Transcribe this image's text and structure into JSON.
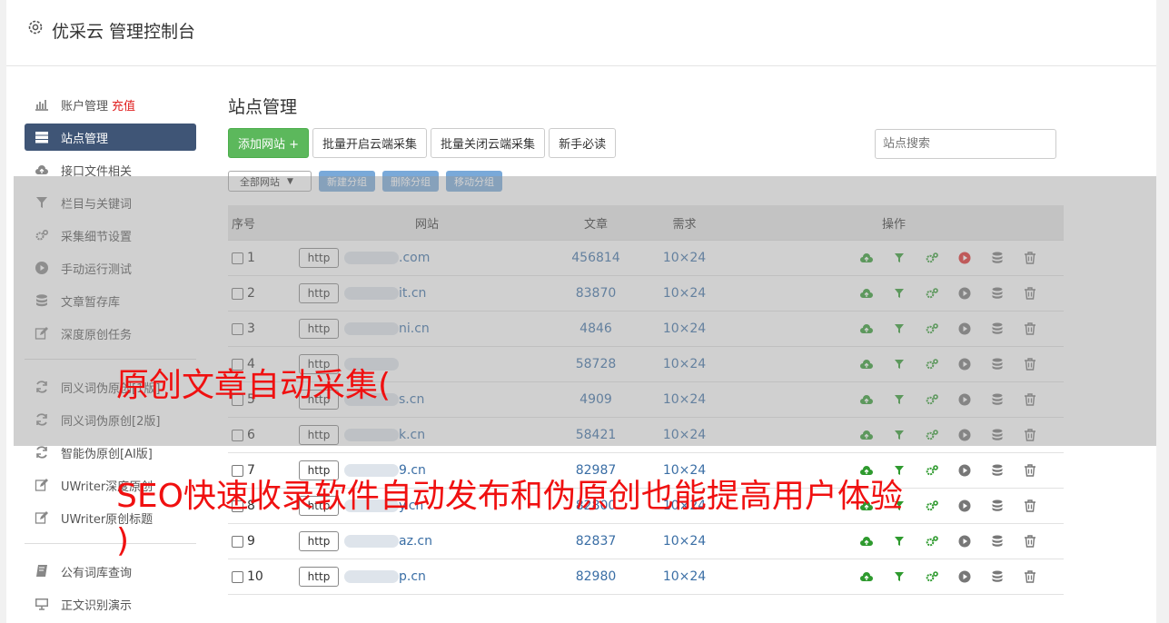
{
  "app": {
    "title": "优采云 管理控制台"
  },
  "sidebar": {
    "items": [
      {
        "label": "账户管理",
        "extra": "充值",
        "icon": "bar-chart-icon"
      },
      {
        "label": "站点管理",
        "icon": "server-icon",
        "active": true
      },
      {
        "label": "接口文件相关",
        "icon": "cloud-upload-icon"
      },
      {
        "label": "栏目与关键词",
        "icon": "filter-icon"
      },
      {
        "label": "采集细节设置",
        "icon": "gears-icon"
      },
      {
        "label": "手动运行测试",
        "icon": "play-circle-icon"
      },
      {
        "label": "文章暂存库",
        "icon": "database-icon"
      },
      {
        "label": "深度原创任务",
        "icon": "edit-icon"
      }
    ],
    "items2": [
      {
        "label": "同义词伪原创[1版]",
        "icon": "refresh-icon"
      },
      {
        "label": "同义词伪原创[2版]",
        "icon": "refresh-icon"
      },
      {
        "label": "智能伪原创[AI版]",
        "icon": "refresh-icon"
      },
      {
        "label": "UWriter深度原创",
        "icon": "edit-icon"
      },
      {
        "label": "UWriter原创标题",
        "icon": "edit-icon"
      }
    ],
    "items3": [
      {
        "label": "公有词库查询",
        "icon": "book-icon"
      },
      {
        "label": "正文识别演示",
        "icon": "monitor-icon"
      }
    ]
  },
  "content": {
    "title": "站点管理",
    "toolbar": {
      "add_site": "添加网站 +",
      "batch_open": "批量开启云端采集",
      "batch_close": "批量关闭云端采集",
      "newbie": "新手必读"
    },
    "search_placeholder": "站点搜索",
    "group_select": "全部网站",
    "group_buttons": {
      "new": "新建分组",
      "delete": "删除分组",
      "move": "移动分组"
    },
    "table": {
      "headers": {
        "no": "序号",
        "site": "网站",
        "articles": "文章",
        "demand": "需求",
        "ops": "操作"
      },
      "http_label": "http",
      "rows": [
        {
          "no": "1",
          "site_suffix": ".com",
          "articles": "456814",
          "demand": "10×24",
          "play_red": true
        },
        {
          "no": "2",
          "site_suffix": "it.cn",
          "articles": "83870",
          "demand": "10×24"
        },
        {
          "no": "3",
          "site_suffix": "ni.cn",
          "articles": "4846",
          "demand": "10×24"
        },
        {
          "no": "4",
          "site_suffix": "",
          "articles": "58728",
          "demand": "10×24"
        },
        {
          "no": "5",
          "site_suffix": "s.cn",
          "articles": "4909",
          "demand": "10×24"
        },
        {
          "no": "6",
          "site_suffix": "k.cn",
          "articles": "58421",
          "demand": "10×24"
        },
        {
          "no": "7",
          "site_suffix": "9.cn",
          "articles": "82987",
          "demand": "10×24"
        },
        {
          "no": "8",
          "site_suffix": "y.cn",
          "articles": "82800",
          "demand": "10×24"
        },
        {
          "no": "9",
          "site_suffix": "az.cn",
          "articles": "82837",
          "demand": "10×24"
        },
        {
          "no": "10",
          "site_suffix": "p.cn",
          "articles": "82980",
          "demand": "10×24"
        }
      ]
    }
  },
  "overlay": {
    "line1": "原创文章自动采集(",
    "line2": "SEO快速收录软件自动发布和伪原创也能提高用户体验",
    "line3": ")"
  },
  "colors": {
    "active_bg": "#3f5576",
    "accent_green": "#5cb85c",
    "link": "#3a6ea5",
    "caption": "#f01010"
  }
}
